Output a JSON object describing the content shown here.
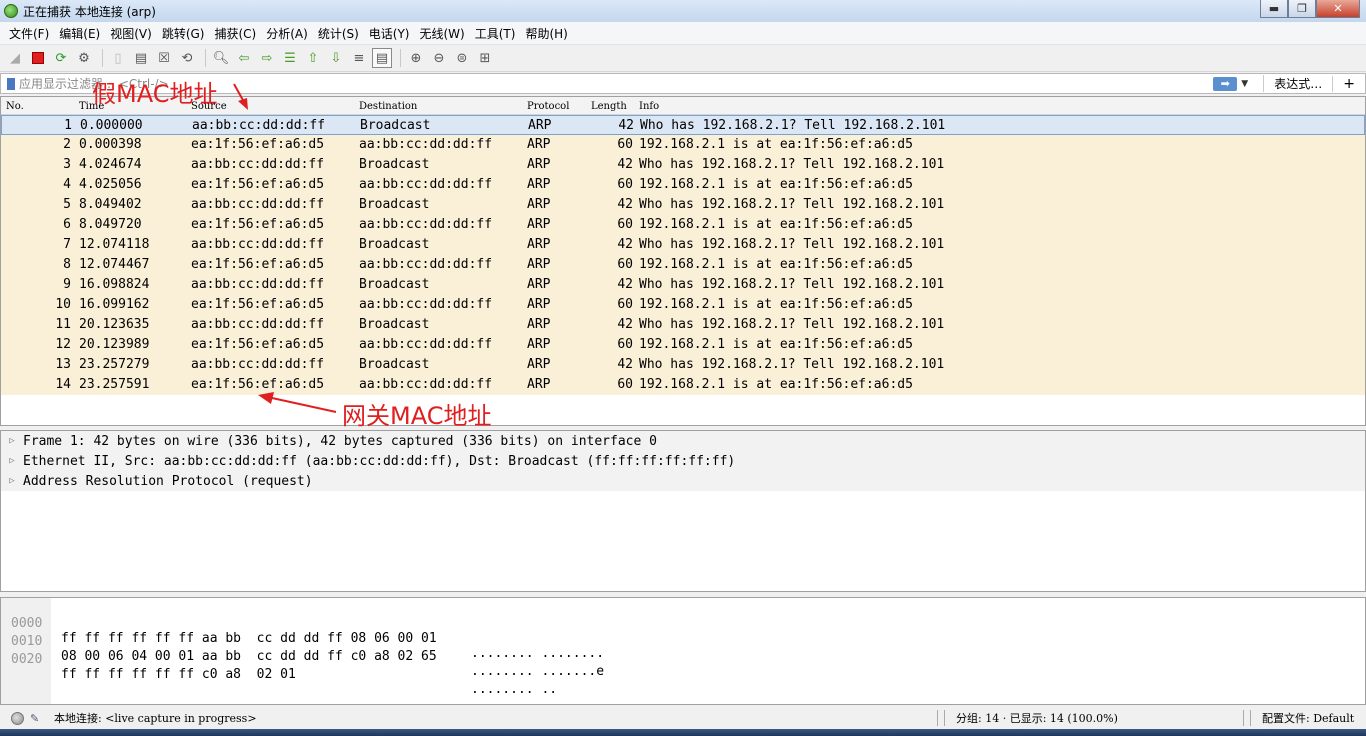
{
  "window": {
    "title": "正在捕获 本地连接 (arp)",
    "btn_min": "▬",
    "btn_max": "❐",
    "btn_close": "✕"
  },
  "menu": [
    "文件(F)",
    "编辑(E)",
    "视图(V)",
    "跳转(G)",
    "捕获(C)",
    "分析(A)",
    "统计(S)",
    "电话(Y)",
    "无线(W)",
    "工具(T)",
    "帮助(H)"
  ],
  "filter": {
    "placeholder": "应用显示过滤器… <Ctrl-/>",
    "apply": "➡",
    "dropdown": "▼",
    "expression": "表达式…",
    "add": "+"
  },
  "columns": {
    "no": "No.",
    "time": "Time",
    "source": "Source",
    "destination": "Destination",
    "protocol": "Protocol",
    "length": "Length",
    "info": "Info"
  },
  "packets": [
    {
      "no": "1",
      "time": "0.000000",
      "src": "aa:bb:cc:dd:dd:ff",
      "dst": "Broadcast",
      "proto": "ARP",
      "len": "42",
      "info": "Who has 192.168.2.1? Tell 192.168.2.101"
    },
    {
      "no": "2",
      "time": "0.000398",
      "src": "ea:1f:56:ef:a6:d5",
      "dst": "aa:bb:cc:dd:dd:ff",
      "proto": "ARP",
      "len": "60",
      "info": "192.168.2.1 is at ea:1f:56:ef:a6:d5"
    },
    {
      "no": "3",
      "time": "4.024674",
      "src": "aa:bb:cc:dd:dd:ff",
      "dst": "Broadcast",
      "proto": "ARP",
      "len": "42",
      "info": "Who has 192.168.2.1? Tell 192.168.2.101"
    },
    {
      "no": "4",
      "time": "4.025056",
      "src": "ea:1f:56:ef:a6:d5",
      "dst": "aa:bb:cc:dd:dd:ff",
      "proto": "ARP",
      "len": "60",
      "info": "192.168.2.1 is at ea:1f:56:ef:a6:d5"
    },
    {
      "no": "5",
      "time": "8.049402",
      "src": "aa:bb:cc:dd:dd:ff",
      "dst": "Broadcast",
      "proto": "ARP",
      "len": "42",
      "info": "Who has 192.168.2.1? Tell 192.168.2.101"
    },
    {
      "no": "6",
      "time": "8.049720",
      "src": "ea:1f:56:ef:a6:d5",
      "dst": "aa:bb:cc:dd:dd:ff",
      "proto": "ARP",
      "len": "60",
      "info": "192.168.2.1 is at ea:1f:56:ef:a6:d5"
    },
    {
      "no": "7",
      "time": "12.074118",
      "src": "aa:bb:cc:dd:dd:ff",
      "dst": "Broadcast",
      "proto": "ARP",
      "len": "42",
      "info": "Who has 192.168.2.1? Tell 192.168.2.101"
    },
    {
      "no": "8",
      "time": "12.074467",
      "src": "ea:1f:56:ef:a6:d5",
      "dst": "aa:bb:cc:dd:dd:ff",
      "proto": "ARP",
      "len": "60",
      "info": "192.168.2.1 is at ea:1f:56:ef:a6:d5"
    },
    {
      "no": "9",
      "time": "16.098824",
      "src": "aa:bb:cc:dd:dd:ff",
      "dst": "Broadcast",
      "proto": "ARP",
      "len": "42",
      "info": "Who has 192.168.2.1? Tell 192.168.2.101"
    },
    {
      "no": "10",
      "time": "16.099162",
      "src": "ea:1f:56:ef:a6:d5",
      "dst": "aa:bb:cc:dd:dd:ff",
      "proto": "ARP",
      "len": "60",
      "info": "192.168.2.1 is at ea:1f:56:ef:a6:d5"
    },
    {
      "no": "11",
      "time": "20.123635",
      "src": "aa:bb:cc:dd:dd:ff",
      "dst": "Broadcast",
      "proto": "ARP",
      "len": "42",
      "info": "Who has 192.168.2.1? Tell 192.168.2.101"
    },
    {
      "no": "12",
      "time": "20.123989",
      "src": "ea:1f:56:ef:a6:d5",
      "dst": "aa:bb:cc:dd:dd:ff",
      "proto": "ARP",
      "len": "60",
      "info": "192.168.2.1 is at ea:1f:56:ef:a6:d5"
    },
    {
      "no": "13",
      "time": "23.257279",
      "src": "aa:bb:cc:dd:dd:ff",
      "dst": "Broadcast",
      "proto": "ARP",
      "len": "42",
      "info": "Who has 192.168.2.1? Tell 192.168.2.101"
    },
    {
      "no": "14",
      "time": "23.257591",
      "src": "ea:1f:56:ef:a6:d5",
      "dst": "aa:bb:cc:dd:dd:ff",
      "proto": "ARP",
      "len": "60",
      "info": "192.168.2.1 is at ea:1f:56:ef:a6:d5"
    }
  ],
  "annotations": {
    "fake_mac": "假MAC地址",
    "gateway_mac": "网关MAC地址",
    "color": "#e02020"
  },
  "details": [
    "Frame 1: 42 bytes on wire (336 bits), 42 bytes captured (336 bits) on interface 0",
    "Ethernet II, Src: aa:bb:cc:dd:dd:ff (aa:bb:cc:dd:dd:ff), Dst: Broadcast (ff:ff:ff:ff:ff:ff)",
    "Address Resolution Protocol (request)"
  ],
  "hex": [
    {
      "offset": "0000",
      "bytes": "ff ff ff ff ff ff aa bb  cc dd dd ff 08 06 00 01",
      "ascii": "........ ........"
    },
    {
      "offset": "0010",
      "bytes": "08 00 06 04 00 01 aa bb  cc dd dd ff c0 a8 02 65",
      "ascii": "........ .......e"
    },
    {
      "offset": "0020",
      "bytes": "ff ff ff ff ff ff c0 a8  02 01",
      "ascii": "........ .."
    }
  ],
  "status": {
    "capture": "本地连接: <live capture in progress>",
    "counts": "分组: 14 · 已显示: 14 (100.0%)",
    "profile": "配置文件: Default"
  }
}
